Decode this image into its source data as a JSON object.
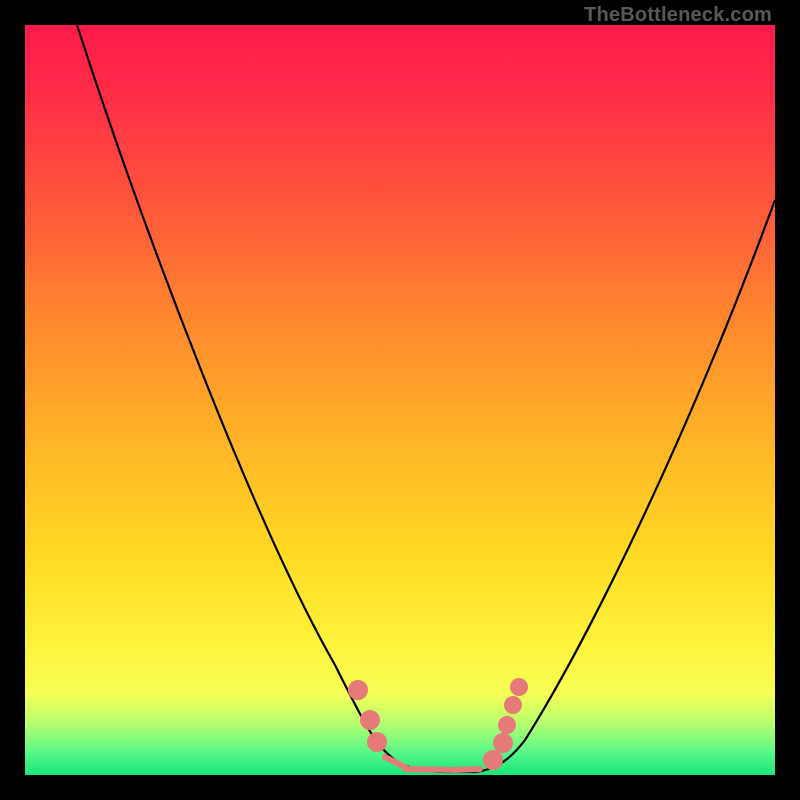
{
  "watermark": "TheBottleneck.com",
  "chart_data": {
    "type": "line",
    "title": "",
    "xlabel": "",
    "ylabel": "",
    "xlim": [
      0,
      100
    ],
    "ylim": [
      0,
      100
    ],
    "grid": false,
    "legend": false,
    "background_gradient": {
      "direction": "vertical",
      "stops": [
        {
          "pos": 0.0,
          "color": "#ff1a4a"
        },
        {
          "pos": 0.25,
          "color": "#ff5a3a"
        },
        {
          "pos": 0.55,
          "color": "#ffb327"
        },
        {
          "pos": 0.82,
          "color": "#fff23a"
        },
        {
          "pos": 0.97,
          "color": "#57f789"
        },
        {
          "pos": 1.0,
          "color": "#18e67b"
        }
      ]
    },
    "series": [
      {
        "name": "bottleneck-curve",
        "color": "#000000",
        "x": [
          0,
          5,
          10,
          15,
          20,
          25,
          30,
          35,
          40,
          45,
          48,
          50,
          52,
          55,
          58,
          60,
          62,
          65,
          70,
          75,
          80,
          85,
          90,
          95,
          100
        ],
        "y": [
          100,
          90,
          80,
          70,
          60,
          50,
          40,
          30,
          20,
          10,
          5,
          2,
          0,
          0,
          0,
          0,
          2,
          6,
          15,
          25,
          36,
          47,
          58,
          69,
          78
        ]
      },
      {
        "name": "highlight-markers",
        "color": "#e67a78",
        "type": "scatter",
        "x": [
          42,
          44,
          49,
          51,
          54,
          58,
          61,
          59,
          60
        ],
        "y": [
          14,
          9,
          2,
          1,
          1,
          2,
          10,
          14,
          5
        ]
      }
    ]
  }
}
